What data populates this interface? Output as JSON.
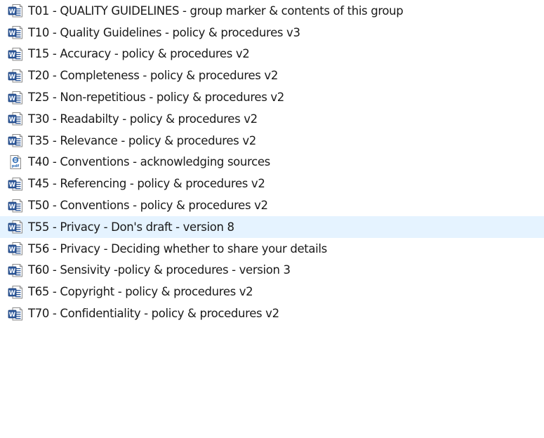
{
  "colors": {
    "word_blue": "#2b579a",
    "word_blue_dark": "#1e4078",
    "pdf_blue": "#2f6db5",
    "hover_background": "#e5f3ff",
    "text": "#1a1a1a"
  },
  "files": [
    {
      "name": "T01 - QUALITY GUIDELINES - group marker & contents of this group",
      "icon": "word-doc-icon",
      "hovered": false
    },
    {
      "name": "T10 - Quality Guidelines - policy & procedures v3",
      "icon": "word-doc-icon",
      "hovered": false
    },
    {
      "name": "T15 - Accuracy - policy & procedures v2",
      "icon": "word-doc-icon",
      "hovered": false
    },
    {
      "name": "T20 - Completeness - policy & procedures v2",
      "icon": "word-doc-icon",
      "hovered": false
    },
    {
      "name": "T25 - Non-repetitious - policy & procedures v2",
      "icon": "word-doc-icon",
      "hovered": false
    },
    {
      "name": "T30 - Readabilty - policy & procedures v2",
      "icon": "word-doc-icon",
      "hovered": false
    },
    {
      "name": "T35 - Relevance - policy & procedures v2",
      "icon": "word-doc-icon",
      "hovered": false
    },
    {
      "name": "T40 - Conventions - acknowledging sources",
      "icon": "pdf-doc-icon",
      "hovered": false
    },
    {
      "name": "T45 - Referencing - policy & procedures v2",
      "icon": "word-doc-icon",
      "hovered": false
    },
    {
      "name": "T50 - Conventions - policy & procedures v2",
      "icon": "word-doc-icon",
      "hovered": false
    },
    {
      "name": "T55 - Privacy - Don's draft - version 8",
      "icon": "word-doc-icon",
      "hovered": true
    },
    {
      "name": "T56 - Privacy - Deciding whether to share your details",
      "icon": "word-doc-icon",
      "hovered": false
    },
    {
      "name": "T60 - Sensivity -policy & procedures - version 3",
      "icon": "word-doc-icon",
      "hovered": false
    },
    {
      "name": "T65 - Copyright - policy & procedures v2",
      "icon": "word-doc-icon",
      "hovered": false
    },
    {
      "name": "T70 - Confidentiality - policy & procedures v2",
      "icon": "word-doc-icon",
      "hovered": false
    }
  ]
}
